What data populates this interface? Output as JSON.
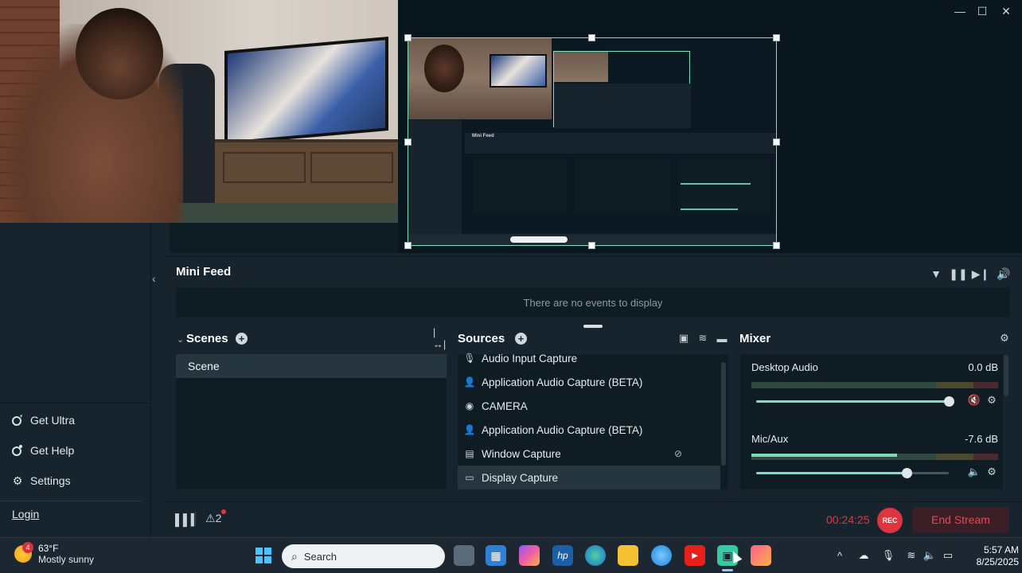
{
  "sidebar": {
    "items": [
      {
        "label": "Get Ultra",
        "icon": "ultra-icon"
      },
      {
        "label": "Get Help",
        "icon": "help-icon"
      },
      {
        "label": "Settings",
        "icon": "gear-icon"
      }
    ],
    "login": "Login"
  },
  "minifeed": {
    "title": "Mini Feed",
    "empty_text": "There are no events to display"
  },
  "scenes": {
    "title": "Scenes",
    "items": [
      "Scene"
    ]
  },
  "sources": {
    "title": "Sources",
    "items": [
      {
        "label": "Audio Input Capture",
        "icon": "microphone-icon"
      },
      {
        "label": "Application Audio Capture (BETA)",
        "icon": "person-icon"
      },
      {
        "label": "CAMERA",
        "icon": "webcam-icon"
      },
      {
        "label": "Application Audio Capture (BETA)",
        "icon": "person-icon"
      },
      {
        "label": "Window Capture",
        "icon": "window-icon"
      },
      {
        "label": "Display Capture",
        "icon": "monitor-icon"
      }
    ]
  },
  "mixer": {
    "title": "Mixer",
    "channels": [
      {
        "name": "Desktop Audio",
        "value": "0.0 dB",
        "meter_level": 0,
        "volume": 1.0
      },
      {
        "name": "Mic/Aux",
        "value": "-7.6 dB",
        "meter_level": 0.59,
        "volume": 0.78
      }
    ]
  },
  "footer": {
    "alerts_count": "2",
    "timer": "00:24:25",
    "rec_label": "REC",
    "end_stream_label": "End Stream"
  },
  "taskbar": {
    "weather_badge": "4",
    "temperature": "63°F",
    "condition": "Mostly sunny",
    "search_placeholder": "Search",
    "time": "5:57 AM",
    "date": "8/25/2025"
  },
  "colors": {
    "accent": "#7fe0c0",
    "danger": "#e0353f",
    "panel": "#17242d",
    "panel_dark": "#0f1c24"
  }
}
